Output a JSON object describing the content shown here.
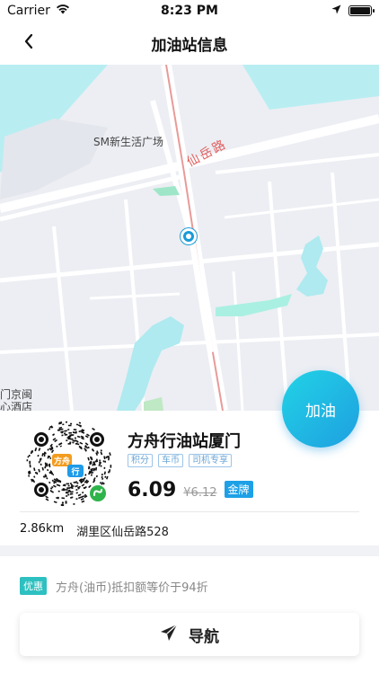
{
  "status_bar": {
    "carrier": "Carrier",
    "time": "8:23 PM",
    "battery_level": 1.0
  },
  "header": {
    "title": "加油站信息",
    "back_icon": "chevron-left-icon"
  },
  "map": {
    "poi_label": "SM新生活广场",
    "road_label": "仙岳路",
    "edge_label_line1": "门京闽",
    "edge_label_line2": "心酒店"
  },
  "refuel_button": {
    "label": "加油"
  },
  "station": {
    "name": "方舟行油站厦门",
    "tags": [
      "积分",
      "车币",
      "司机专享"
    ],
    "price": "6.09",
    "original_price": "¥6.12",
    "grade_badge": "金牌",
    "distance": "2.86km",
    "address": "湖里区仙岳路528",
    "qr_brand": "方舟行"
  },
  "promotion": {
    "badge": "优惠",
    "text": "方舟(油币)抵扣额等价于94折"
  },
  "navigation_button": {
    "label": "导航",
    "icon": "paper-plane-icon"
  },
  "colors": {
    "accent": "#1ea0e6",
    "promo": "#2ec0c0",
    "road": "#e06060"
  }
}
